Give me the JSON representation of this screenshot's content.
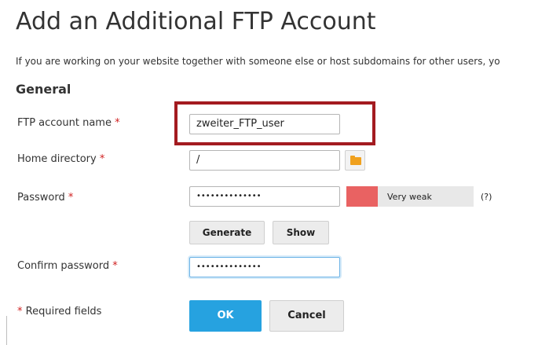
{
  "page": {
    "title": "Add an Additional FTP Account",
    "intro": "If you are working on your website together with someone else or host subdomains for other users, yo",
    "section": "General"
  },
  "form": {
    "ftp_name": {
      "label": "FTP account name",
      "value": "zweiter_FTP_user"
    },
    "home_dir": {
      "label": "Home directory",
      "value": "/"
    },
    "password": {
      "label": "Password",
      "value": "••••••••••••••",
      "strength": "Very weak",
      "help": "(?)"
    },
    "confirm": {
      "label": "Confirm password",
      "value": "••••••••••••••"
    },
    "required_marker": "*",
    "required_note": "Required fields"
  },
  "buttons": {
    "generate": "Generate",
    "show": "Show",
    "ok": "OK",
    "cancel": "Cancel"
  },
  "colors": {
    "accent": "#26a2e0",
    "highlight": "#a31b20",
    "weak": "#e96262",
    "required": "#d02020"
  },
  "icons": {
    "home_dir_browse": "folder-icon"
  }
}
